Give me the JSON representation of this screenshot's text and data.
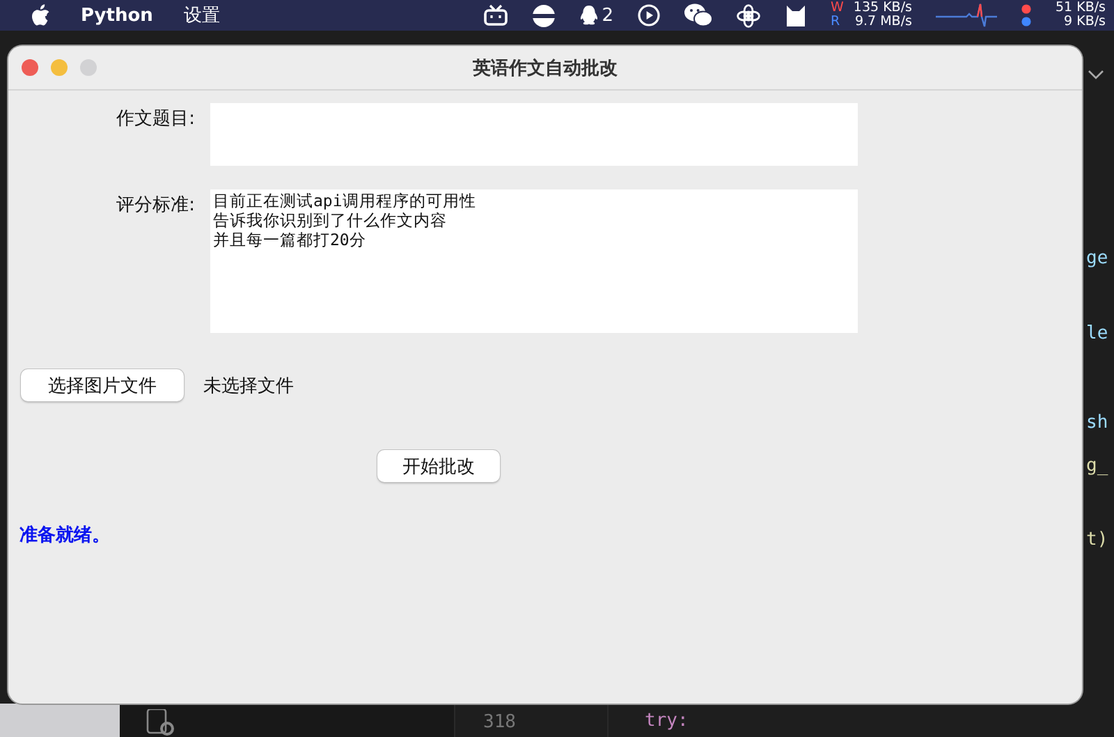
{
  "menubar": {
    "app": "Python",
    "menus": [
      "设置"
    ],
    "qq_count": "2",
    "io_labels": [
      "W",
      "R"
    ],
    "io_rates": [
      "135 KB/s",
      "9.7 MB/s"
    ],
    "net_rates": [
      "51 KB/s",
      "9 KB/s"
    ]
  },
  "background_editor": {
    "line_number": "318",
    "code": "try:",
    "fragments": [
      "ge",
      "le",
      "sh",
      "g_",
      "t)"
    ]
  },
  "window": {
    "title": "英语作文自动批改",
    "fields": [
      {
        "label": "作文题目:",
        "kind": "line"
      },
      {
        "label": "评分标准:",
        "kind": "area",
        "lines": [
          "目前正在测试api调用程序的可用性",
          "告诉我你识别到了什么作文内容",
          "并且每一篇都打20分"
        ]
      }
    ],
    "file_button": "选择图片文件",
    "file_status": "未选择文件",
    "start_button": "开始批改",
    "status": "准备就绪。"
  }
}
